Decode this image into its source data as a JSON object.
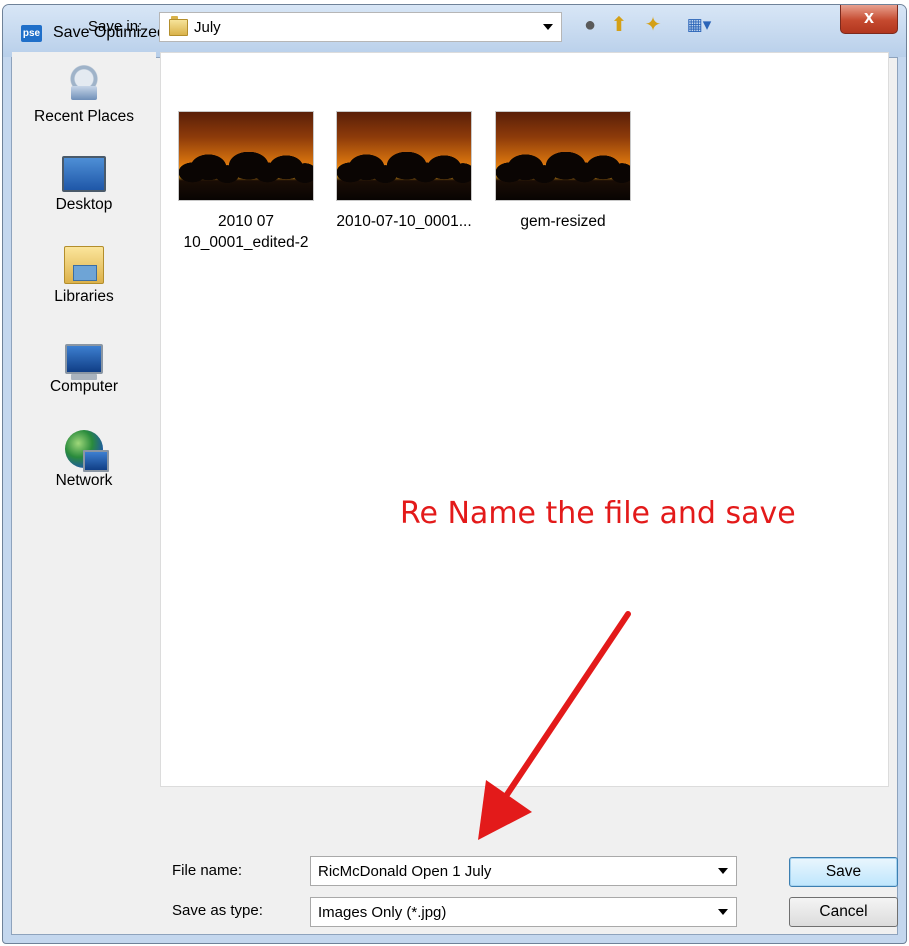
{
  "window": {
    "title": "Save Optimized As",
    "app_icon_text": "pse",
    "close_glyph": "x"
  },
  "toolbar": {
    "save_in_label": "Save in:",
    "save_in_value": "July",
    "icons": [
      "back-icon",
      "up-folder-icon",
      "new-folder-icon",
      "view-menu-icon"
    ]
  },
  "places": [
    {
      "label": "Recent Places",
      "icon": "recent-places-icon"
    },
    {
      "label": "Desktop",
      "icon": "desktop-icon"
    },
    {
      "label": "Libraries",
      "icon": "libraries-icon"
    },
    {
      "label": "Computer",
      "icon": "computer-icon"
    },
    {
      "label": "Network",
      "icon": "network-icon"
    }
  ],
  "files": [
    {
      "name_line1": "2010 07",
      "name_line2": "10_0001_edited-2"
    },
    {
      "name_line1": "2010-07-10_0001...",
      "name_line2": ""
    },
    {
      "name_line1": "gem-resized",
      "name_line2": ""
    }
  ],
  "annotation": {
    "text": "Re Name the file and save",
    "color": "#e31a1a"
  },
  "form": {
    "file_name_label": "File name:",
    "file_name_value": "RicMcDonald Open 1 July",
    "save_as_type_label": "Save as type:",
    "save_as_type_value": "Images Only (*.jpg)"
  },
  "buttons": {
    "save": "Save",
    "cancel": "Cancel"
  }
}
